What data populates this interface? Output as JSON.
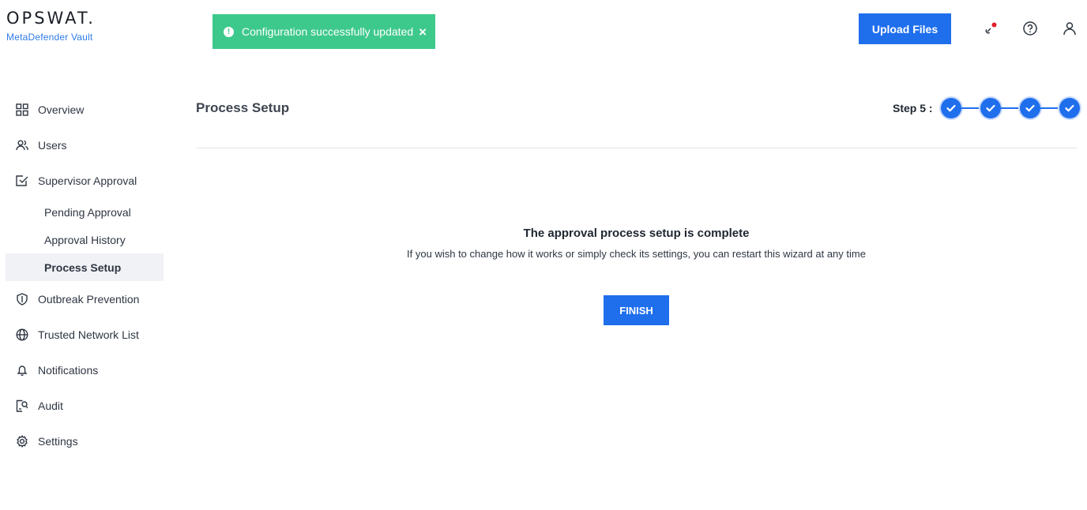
{
  "brand": {
    "logo_text": "OPSWAT.",
    "product": "MetaDefender Vault"
  },
  "toast": {
    "message": "Configuration successfully updated",
    "icon": "info-icon",
    "close_icon": "close-icon",
    "color": "#3ec98c"
  },
  "header": {
    "upload_label": "Upload Files",
    "icons": [
      "link-notification-icon",
      "help-icon",
      "user-icon"
    ],
    "accent": "#1f6fed"
  },
  "sidebar": {
    "items": [
      {
        "label": "Overview",
        "icon": "grid-icon"
      },
      {
        "label": "Users",
        "icon": "users-icon"
      },
      {
        "label": "Supervisor Approval",
        "icon": "checkbox-icon"
      },
      {
        "label": "Outbreak Prevention",
        "icon": "shield-icon"
      },
      {
        "label": "Trusted Network List",
        "icon": "globe-icon"
      },
      {
        "label": "Notifications",
        "icon": "bell-icon"
      },
      {
        "label": "Audit",
        "icon": "audit-icon"
      },
      {
        "label": "Settings",
        "icon": "gear-icon"
      }
    ],
    "subitems": [
      {
        "label": "Pending Approval"
      },
      {
        "label": "Approval History"
      },
      {
        "label": "Process Setup",
        "active": true
      }
    ]
  },
  "main": {
    "title": "Process Setup",
    "step_label": "Step 5 :",
    "steps_completed": 4,
    "heading": "The approval process setup is complete",
    "description": "If you wish to change how it works or simply check its settings, you can restart this wizard at any time",
    "finish_label": "FINISH"
  }
}
